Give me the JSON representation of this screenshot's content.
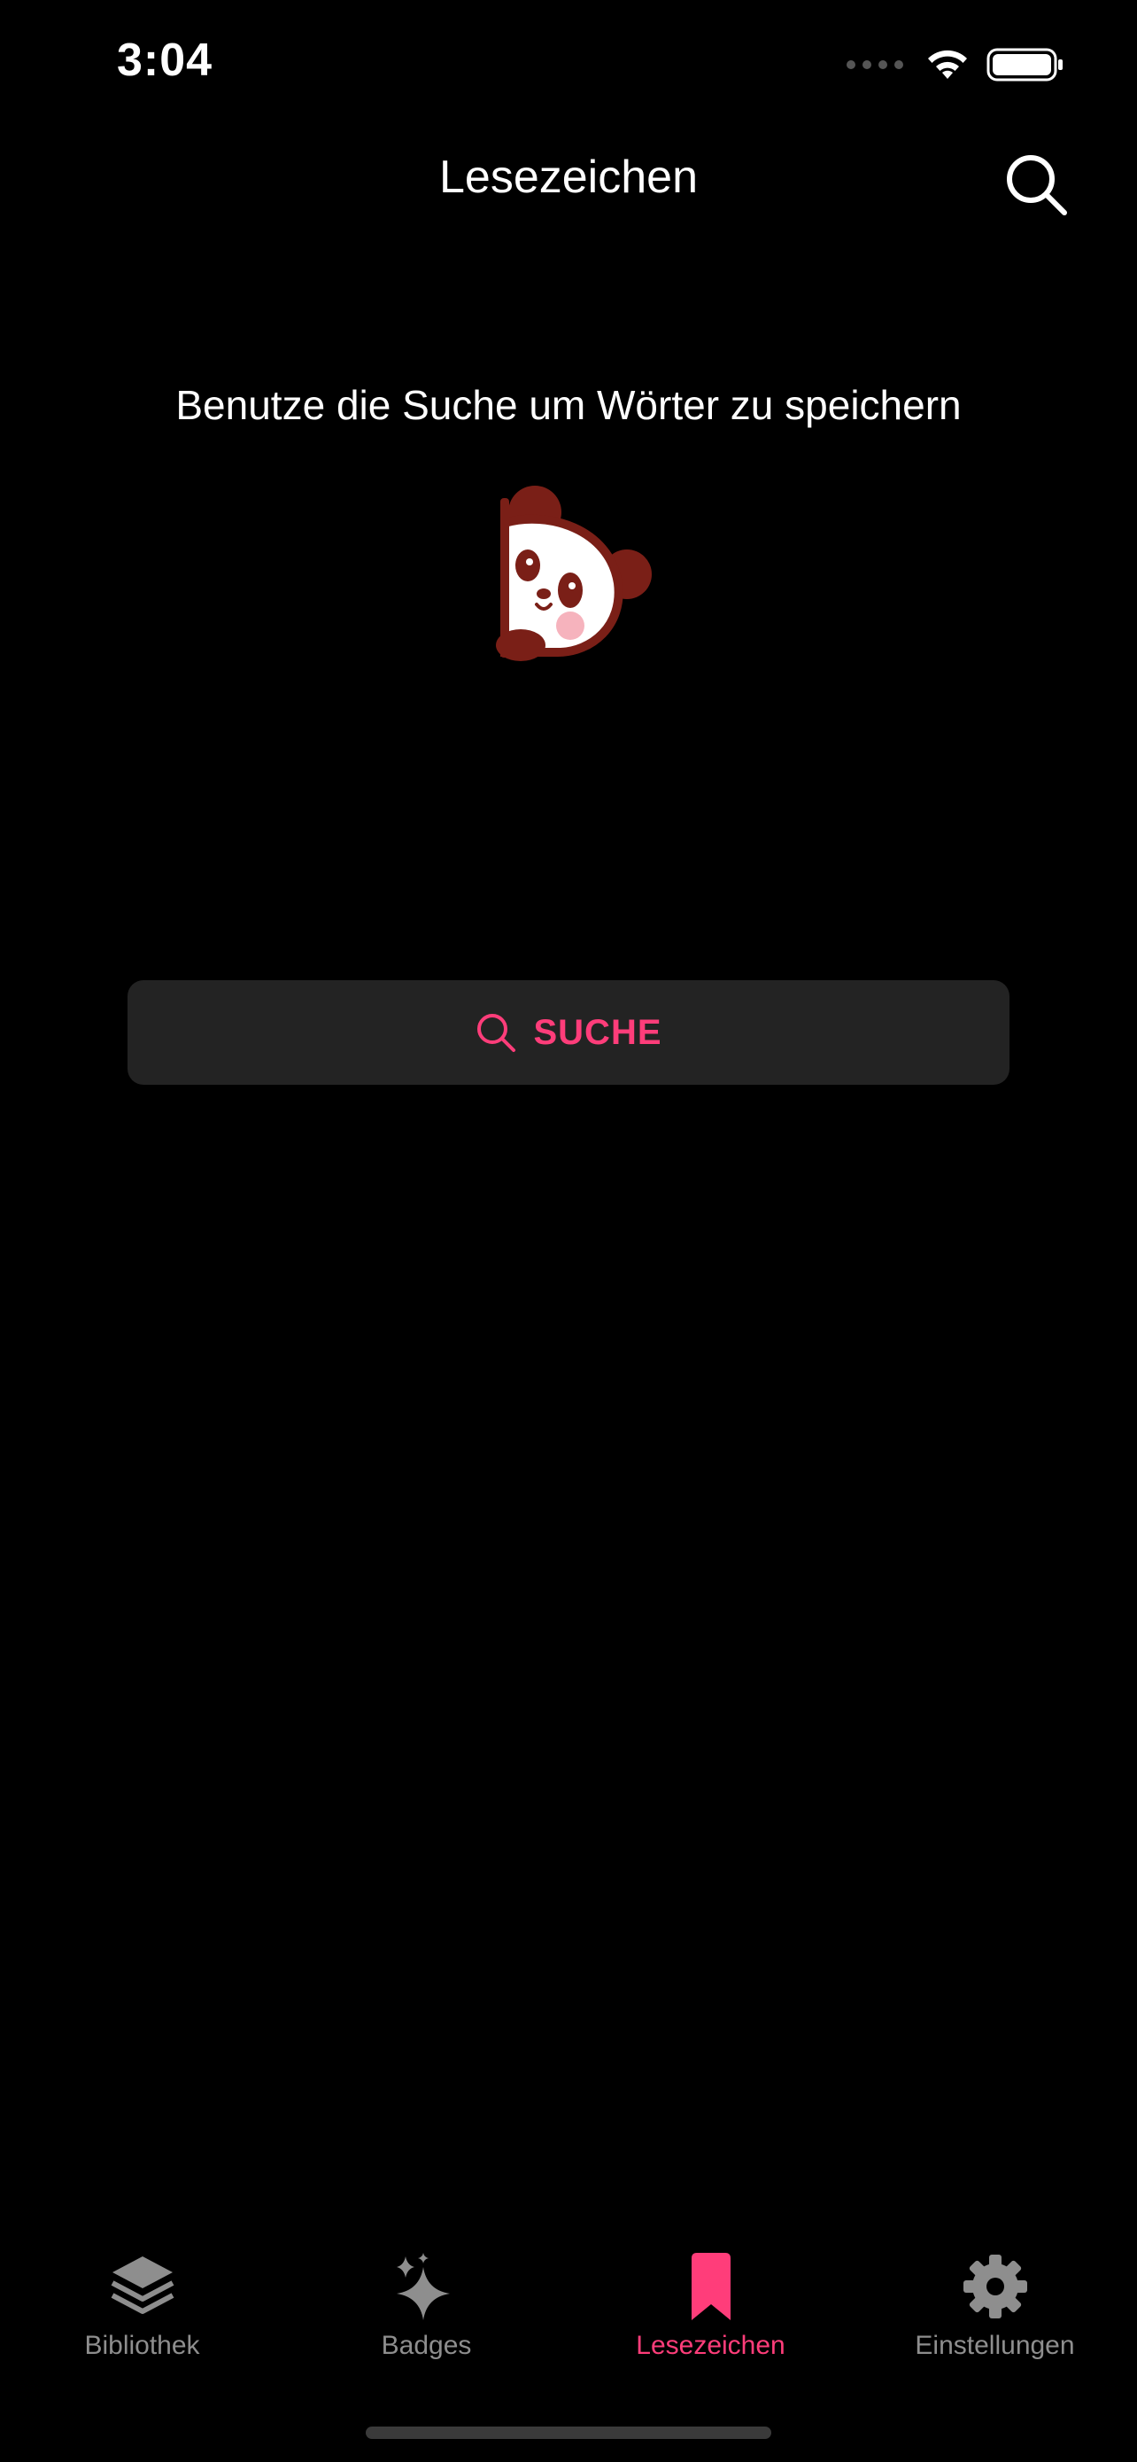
{
  "status_bar": {
    "time": "3:04",
    "icons": [
      "signal-dots-icon",
      "wifi-icon",
      "battery-icon"
    ]
  },
  "nav": {
    "title": "Lesezeichen",
    "search_icon": "search-icon"
  },
  "empty_state": {
    "message": "Benutze die Suche um Wörter zu speichern",
    "illustration": "panda-peek-illustration",
    "button_label": "SUCHE",
    "button_icon": "search-icon"
  },
  "tabbar": {
    "tabs": [
      {
        "label": "Bibliothek",
        "icon": "stack-layers-icon",
        "active": false
      },
      {
        "label": "Badges",
        "icon": "sparkles-icon",
        "active": false
      },
      {
        "label": "Lesezeichen",
        "icon": "bookmark-icon",
        "active": true
      },
      {
        "label": "Einstellungen",
        "icon": "gear-icon",
        "active": false
      }
    ]
  },
  "colors": {
    "background": "#000000",
    "accent": "#ff3d7a",
    "button_background": "#232323",
    "inactive_tab": "#8e8e8e",
    "panda_brown": "#7a1f17"
  }
}
